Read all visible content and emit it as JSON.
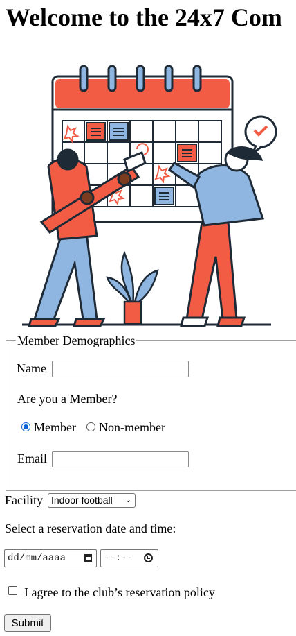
{
  "page": {
    "title": "Welcome to the 24x7 Com"
  },
  "hero": {
    "image_description_icon": "calendar-illustration-icon"
  },
  "colors": {
    "accent_red": "#f25c45",
    "accent_blue": "#8fb6e0",
    "ink": "#1f2a37",
    "radio_blue": "#0b63d6"
  },
  "demographics": {
    "legend": "Member Demographics",
    "name_label": "Name",
    "name_value": "",
    "member_question": "Are you a Member?",
    "options": [
      {
        "label": "Member",
        "checked": true
      },
      {
        "label": "Non-member",
        "checked": false
      }
    ],
    "email_label": "Email",
    "email_value": ""
  },
  "facility": {
    "label": "Facility",
    "selected": "Indoor football"
  },
  "reservation": {
    "label": "Select a reservation date and time:",
    "date_placeholder": "dd/mm/aaaa",
    "time_placeholder": "--:--"
  },
  "policy": {
    "label": "I agree to the club’s reservation policy",
    "checked": false
  },
  "submit_label": "Submit"
}
